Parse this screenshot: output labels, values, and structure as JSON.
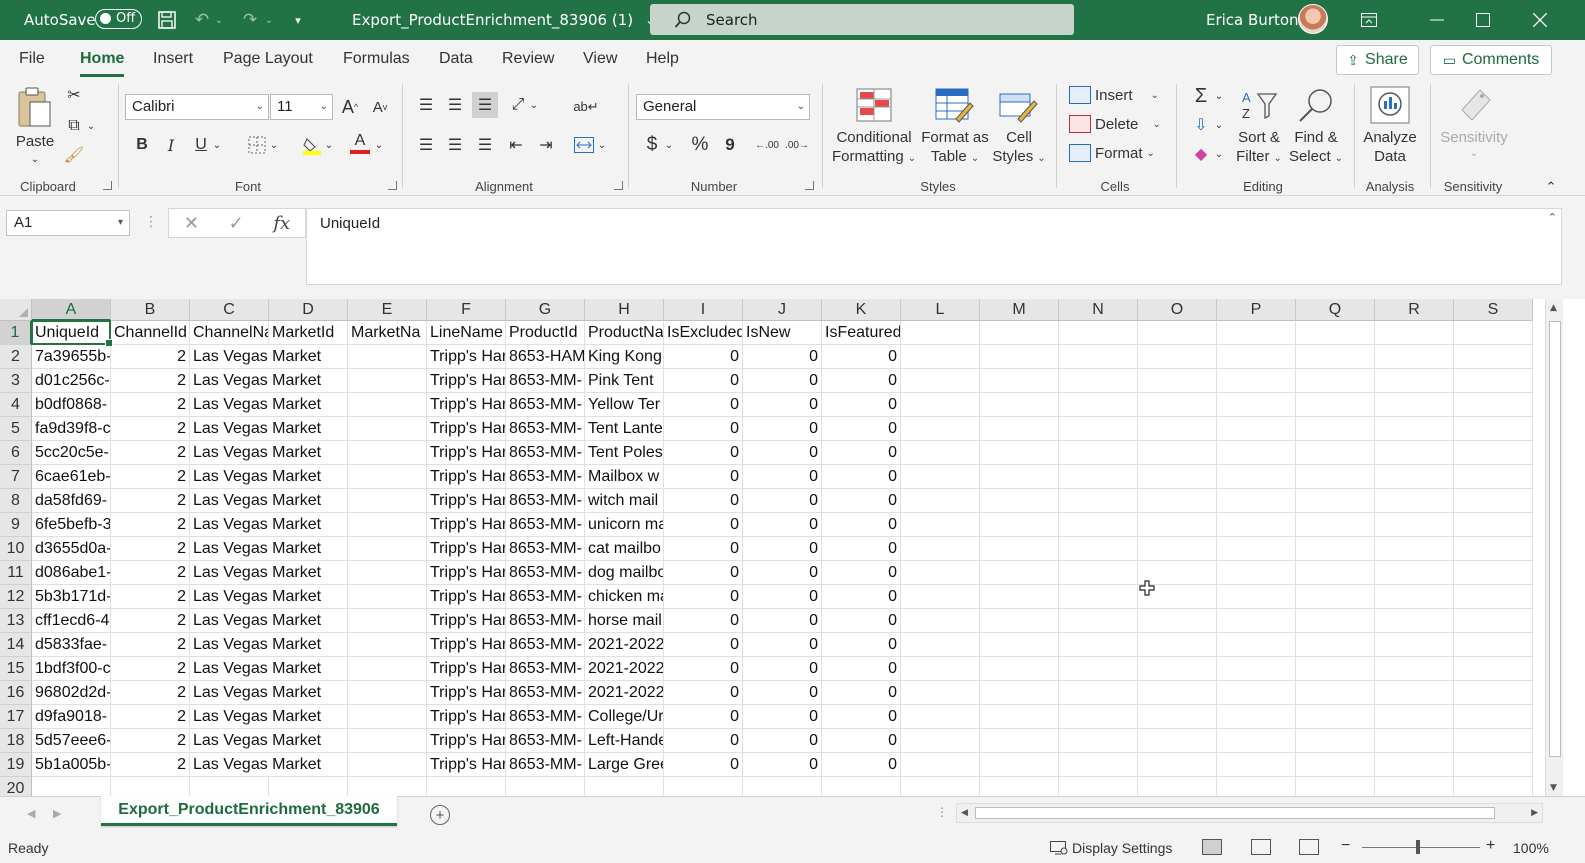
{
  "titlebar": {
    "autosave_label": "AutoSave",
    "autosave_state": "Off",
    "doc_title": "Export_ProductEnrichment_83906 (1)",
    "doc_title_caret": "⌄",
    "search_placeholder": "Search",
    "user_name": "Erica Burton",
    "accent_color": "#217346"
  },
  "ribbon_tabs": [
    "File",
    "Home",
    "Insert",
    "Page Layout",
    "Formulas",
    "Data",
    "Review",
    "View",
    "Help"
  ],
  "actions": {
    "share": "Share",
    "comments": "Comments"
  },
  "ribbon": {
    "clipboard": {
      "label": "Clipboard",
      "paste": "Paste"
    },
    "font": {
      "label": "Font",
      "font_name": "Calibri",
      "font_size": "11",
      "bold": "B",
      "italic": "I",
      "underline": "U",
      "grow": "A",
      "shrink": "A",
      "font_color": "A"
    },
    "alignment": {
      "label": "Alignment"
    },
    "number": {
      "label": "Number",
      "format": "General",
      "currency": "$",
      "percent": "%",
      "comma": "9"
    },
    "styles": {
      "label": "Styles",
      "conditional_1": "Conditional",
      "conditional_2": "Formatting",
      "format_table_1": "Format as",
      "format_table_2": "Table",
      "cell_styles_1": "Cell",
      "cell_styles_2": "Styles"
    },
    "cells": {
      "label": "Cells",
      "insert": "Insert",
      "delete": "Delete",
      "format": "Format"
    },
    "editing": {
      "label": "Editing",
      "sort_1": "Sort &",
      "sort_2": "Filter",
      "find_1": "Find &",
      "find_2": "Select"
    },
    "analysis": {
      "label": "Analysis",
      "analyze_1": "Analyze",
      "analyze_2": "Data"
    },
    "sensitivity": {
      "label": "Sensitivity",
      "button": "Sensitivity"
    }
  },
  "formula_bar": {
    "name_box": "A1",
    "fx": "fx",
    "content": "UniqueId"
  },
  "sheet": {
    "columns": [
      "A",
      "B",
      "C",
      "D",
      "E",
      "F",
      "G",
      "H",
      "I",
      "J",
      "K",
      "L",
      "M",
      "N",
      "O",
      "P",
      "Q",
      "R",
      "S"
    ],
    "header_row": [
      "UniqueId",
      "ChannelId",
      "ChannelNa",
      "MarketId",
      "MarketNa",
      "LineName",
      "ProductId",
      "ProductNa",
      "IsExcluded",
      "IsNew",
      "IsFeatured"
    ],
    "rows": [
      [
        "7a39655b-",
        "2",
        "Las Vegas Market",
        "",
        "Tripp's Har",
        "8653-HAM",
        "King Kong I",
        "0",
        "0",
        "0"
      ],
      [
        "d01c256c-",
        "2",
        "Las Vegas Market",
        "",
        "Tripp's Har",
        "8653-MM-",
        "Pink Tent",
        "0",
        "0",
        "0"
      ],
      [
        "b0df0868-",
        "2",
        "Las Vegas Market",
        "",
        "Tripp's Har",
        "8653-MM-",
        "Yellow Ter",
        "0",
        "0",
        "0"
      ],
      [
        "fa9d39f8-c",
        "2",
        "Las Vegas Market",
        "",
        "Tripp's Har",
        "8653-MM-",
        "Tent Lante",
        "0",
        "0",
        "0"
      ],
      [
        "5cc20c5e-",
        "2",
        "Las Vegas Market",
        "",
        "Tripp's Har",
        "8653-MM-",
        "Tent Poles",
        "0",
        "0",
        "0"
      ],
      [
        "6cae61eb-",
        "2",
        "Las Vegas Market",
        "",
        "Tripp's Har",
        "8653-MM-",
        "Mailbox w",
        "0",
        "0",
        "0"
      ],
      [
        "da58fd69-",
        "2",
        "Las Vegas Market",
        "",
        "Tripp's Har",
        "8653-MM-",
        "witch mail",
        "0",
        "0",
        "0"
      ],
      [
        "6fe5befb-3",
        "2",
        "Las Vegas Market",
        "",
        "Tripp's Har",
        "8653-MM-",
        "unicorn ma",
        "0",
        "0",
        "0"
      ],
      [
        "d3655d0a-",
        "2",
        "Las Vegas Market",
        "",
        "Tripp's Har",
        "8653-MM-",
        "cat mailbo",
        "0",
        "0",
        "0"
      ],
      [
        "d086abe1-",
        "2",
        "Las Vegas Market",
        "",
        "Tripp's Har",
        "8653-MM-",
        "dog mailbo",
        "0",
        "0",
        "0"
      ],
      [
        "5b3b171d-",
        "2",
        "Las Vegas Market",
        "",
        "Tripp's Har",
        "8653-MM-",
        "chicken ma",
        "0",
        "0",
        "0"
      ],
      [
        "cff1ecd6-4",
        "2",
        "Las Vegas Market",
        "",
        "Tripp's Har",
        "8653-MM-",
        "horse mail",
        "0",
        "0",
        "0"
      ],
      [
        "d5833fae-",
        "2",
        "Las Vegas Market",
        "",
        "Tripp's Har",
        "8653-MM-",
        "2021-2022",
        "0",
        "0",
        "0"
      ],
      [
        "1bdf3f00-c",
        "2",
        "Las Vegas Market",
        "",
        "Tripp's Har",
        "8653-MM-",
        "2021-2022",
        "0",
        "0",
        "0"
      ],
      [
        "96802d2d-",
        "2",
        "Las Vegas Market",
        "",
        "Tripp's Har",
        "8653-MM-",
        "2021-2022",
        "0",
        "0",
        "0"
      ],
      [
        "d9fa9018-",
        "2",
        "Las Vegas Market",
        "",
        "Tripp's Har",
        "8653-MM-",
        "College/Ur",
        "0",
        "0",
        "0"
      ],
      [
        "5d57eee6-",
        "2",
        "Las Vegas Market",
        "",
        "Tripp's Har",
        "8653-MM-",
        "Left-Hande",
        "0",
        "0",
        "0"
      ],
      [
        "5b1a005b-",
        "2",
        "Las Vegas Market",
        "",
        "Tripp's Har",
        "8653-MM-",
        "Large Gree",
        "0",
        "0",
        "0"
      ]
    ]
  },
  "sheet_tabs": {
    "active": "Export_ProductEnrichment_83906",
    "add": "+"
  },
  "statusbar": {
    "ready": "Ready",
    "display_settings": "Display Settings",
    "zoom_minus": "−",
    "zoom_plus": "+",
    "zoom": "100%"
  }
}
